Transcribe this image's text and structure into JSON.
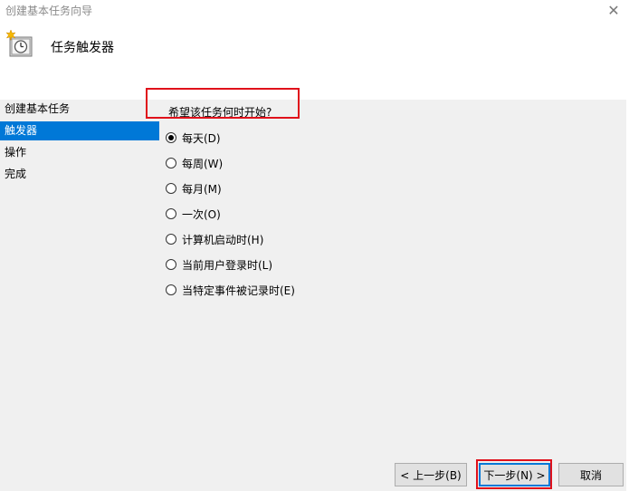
{
  "window": {
    "title": "创建基本任务向导",
    "close_glyph": "✕"
  },
  "header": {
    "title": "任务触发器",
    "icon": "task-scheduler-clock-icon"
  },
  "nav": {
    "items": [
      {
        "label": "创建基本任务",
        "selected": false
      },
      {
        "label": "触发器",
        "selected": true
      },
      {
        "label": "操作",
        "selected": false
      },
      {
        "label": "完成",
        "selected": false
      }
    ]
  },
  "main": {
    "question": "希望该任务何时开始?",
    "options": [
      {
        "label": "每天(D)",
        "checked": true
      },
      {
        "label": "每周(W)",
        "checked": false
      },
      {
        "label": "每月(M)",
        "checked": false
      },
      {
        "label": "一次(O)",
        "checked": false
      },
      {
        "label": "计算机启动时(H)",
        "checked": false
      },
      {
        "label": "当前用户登录时(L)",
        "checked": false
      },
      {
        "label": "当特定事件被记录时(E)",
        "checked": false
      }
    ]
  },
  "buttons": {
    "back": "< 上一步(B)",
    "next": "下一步(N) >",
    "cancel": "取消"
  },
  "colors": {
    "selection": "#0078d7",
    "annotation": "#e0111b"
  }
}
